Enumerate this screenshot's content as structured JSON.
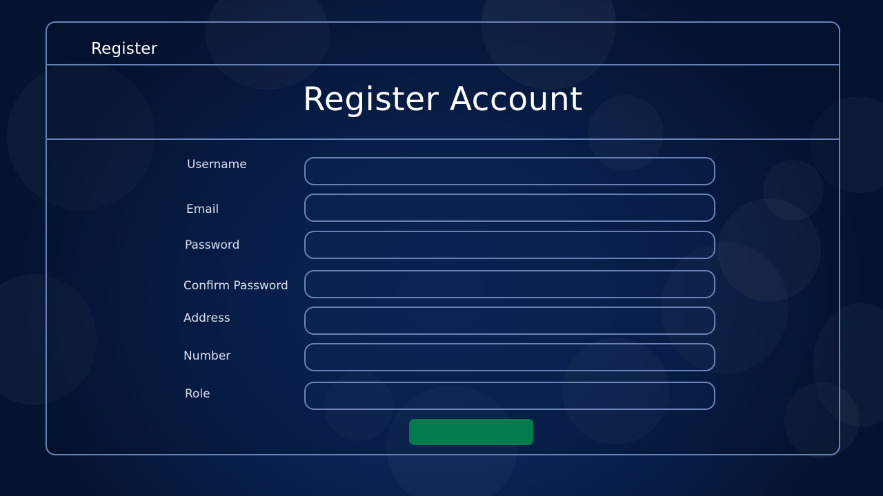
{
  "header": {
    "brand": "Register"
  },
  "main": {
    "title": "Register Account",
    "fields": [
      {
        "label": "Username",
        "value": "",
        "placeholder": ""
      },
      {
        "label": "Email",
        "value": "",
        "placeholder": ""
      },
      {
        "label": "Password",
        "value": "",
        "placeholder": ""
      },
      {
        "label": "Confirm Password",
        "value": "",
        "placeholder": ""
      },
      {
        "label": "Address",
        "value": "",
        "placeholder": ""
      },
      {
        "label": "Number",
        "value": "",
        "placeholder": ""
      },
      {
        "label": "Role",
        "value": "",
        "placeholder": ""
      }
    ],
    "submit_label": ""
  },
  "colors": {
    "background": "#0a2556",
    "border": "#6a82b3",
    "submit_button": "#037c4d",
    "text": "#ffffff"
  }
}
